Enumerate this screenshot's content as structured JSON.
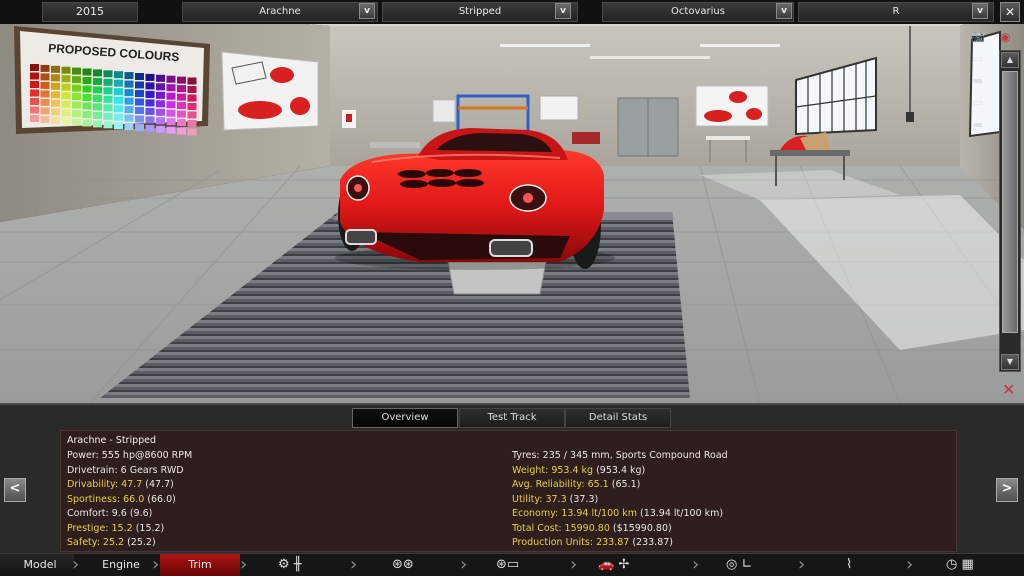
{
  "topbar": {
    "year": "2015",
    "model": "Arachne",
    "trim": "Stripped",
    "engine": "Octovarius",
    "variant": "R",
    "dropdown_glyph": "v",
    "close_glyph": "✕"
  },
  "garage": {
    "poster_title": "PROPOSED COLOURS"
  },
  "camera_icons": [
    "camera-icon",
    "eye-icon",
    "car-front-icon",
    "car-side-icon",
    "car-rear-icon"
  ],
  "scroll": {
    "up_glyph": "▲",
    "down_glyph": "▼"
  },
  "panel": {
    "tabs": [
      "Overview",
      "Test Track",
      "Detail Stats"
    ],
    "active_tab": "Overview",
    "title": "Arachne - Stripped",
    "left": [
      {
        "text": "Power: 555 hp@8600 RPM",
        "color": "white"
      },
      {
        "text": "Drivetrain: 6 Gears RWD",
        "color": "white"
      },
      {
        "label": "Drivability: 47.7",
        "extra": " (47.7)",
        "color": "yellow"
      },
      {
        "label": "Sportiness: 66.0",
        "extra": " (66.0)",
        "color": "yellow"
      },
      {
        "label": "Comfort: 9.6",
        "extra": " (9.6)",
        "color": "white"
      },
      {
        "label": "Prestige: 15.2",
        "extra": " (15.2)",
        "color": "yellow"
      },
      {
        "label": "Safety: 25.2",
        "extra": " (25.2)",
        "color": "yellow"
      }
    ],
    "right": [
      {
        "text": "Tyres: 235 / 345 mm, Sports Compound Road",
        "color": "white"
      },
      {
        "label": "Weight: 953.4 kg",
        "extra": " (953.4 kg)",
        "color": "yellow"
      },
      {
        "label": "Avg. Reliability: 65.1",
        "extra": " (65.1)",
        "color": "yellow"
      },
      {
        "label": "Utility: 37.3",
        "extra": " (37.3)",
        "color": "yellow"
      },
      {
        "label": "Economy: 13.94 lt/100 km",
        "extra": " (13.94 lt/100 km)",
        "color": "yellow"
      },
      {
        "label": "Total Cost: 15990.80",
        "extra": " ($15990.80)",
        "color": "yellow"
      },
      {
        "label": "Production Units: 233.87",
        "extra": " (233.87)",
        "color": "yellow"
      }
    ],
    "prev_glyph": "<",
    "next_glyph": ">"
  },
  "nav": {
    "model": "Model",
    "engine": "Engine",
    "trim": "Trim",
    "icons": [
      "engine-gearbox-icon",
      "wheels-icon",
      "suspension-icon",
      "car-body-fan-icon",
      "interior-seat-icon",
      "shock-absorber-icon",
      "test-flag-icon"
    ]
  },
  "colors": {
    "car_red": "#e01818",
    "accent_yellow": "#e8d23a",
    "panel_bg": "#2e1e1e"
  }
}
